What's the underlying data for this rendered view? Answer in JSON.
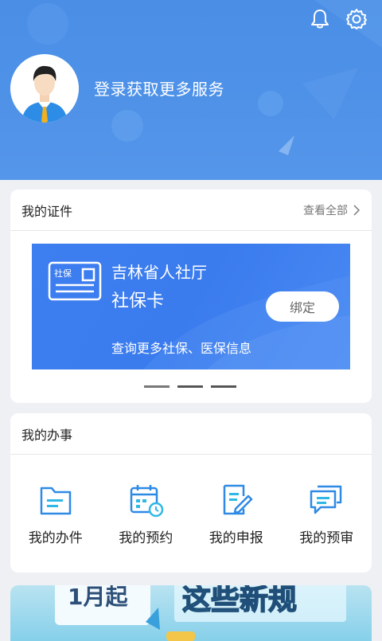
{
  "header": {
    "login_text": "登录获取更多服务",
    "bell_icon": "bell-icon",
    "settings_icon": "gear-icon"
  },
  "certificates": {
    "title": "我的证件",
    "view_all": "查看全部",
    "card": {
      "org": "吉林省人社厅",
      "name": "社保卡",
      "icon_text": "社保",
      "bind_label": "绑定",
      "more": "查询更多社保、医保信息"
    },
    "pager_count": 3,
    "active_page": 1
  },
  "tasks": {
    "title": "我的办事",
    "items": [
      {
        "label": "我的办件",
        "icon": "folder-icon"
      },
      {
        "label": "我的预约",
        "icon": "calendar-clock-icon"
      },
      {
        "label": "我的申报",
        "icon": "edit-document-icon"
      },
      {
        "label": "我的预审",
        "icon": "chat-icon"
      }
    ]
  },
  "banner": {
    "text_left": "1月起",
    "text_right": "这些新规"
  },
  "colors": {
    "header_blue": "#4a8ee6",
    "card_blue": "#3d7ff0",
    "icon_blue": "#2f8ae6"
  }
}
